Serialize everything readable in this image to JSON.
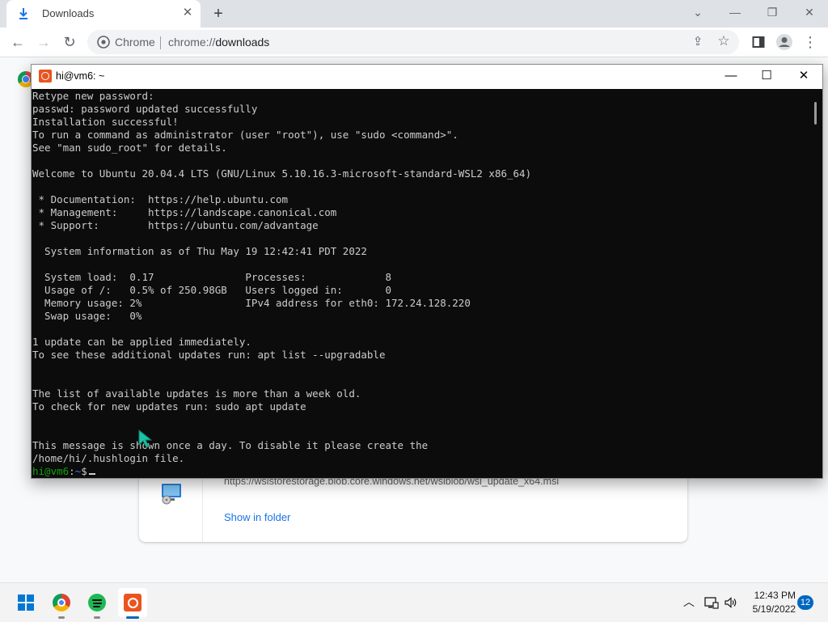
{
  "browser": {
    "tab": {
      "title": "Downloads",
      "icon": "download-icon"
    },
    "omnibox": {
      "site": "Chrome",
      "url_scheme": "chrome://",
      "url_path": "downloads"
    },
    "download_item": {
      "url": "https://wslstorestorage.blob.core.windows.net/wslblob/wsl_update_x64.msi",
      "show_in_folder": "Show in folder"
    }
  },
  "terminal": {
    "title": "hi@vm6: ~",
    "lines": [
      "Retype new password:",
      "passwd: password updated successfully",
      "Installation successful!",
      "To run a command as administrator (user \"root\"), use \"sudo <command>\".",
      "See \"man sudo_root\" for details.",
      "",
      "Welcome to Ubuntu 20.04.4 LTS (GNU/Linux 5.10.16.3-microsoft-standard-WSL2 x86_64)",
      "",
      " * Documentation:  https://help.ubuntu.com",
      " * Management:     https://landscape.canonical.com",
      " * Support:        https://ubuntu.com/advantage",
      "",
      "  System information as of Thu May 19 12:42:41 PDT 2022",
      "",
      "  System load:  0.17               Processes:             8",
      "  Usage of /:   0.5% of 250.98GB   Users logged in:       0",
      "  Memory usage: 2%                 IPv4 address for eth0: 172.24.128.220",
      "  Swap usage:   0%",
      "",
      "1 update can be applied immediately.",
      "To see these additional updates run: apt list --upgradable",
      "",
      "",
      "The list of available updates is more than a week old.",
      "To check for new updates run: sudo apt update",
      "",
      "",
      "This message is shown once a day. To disable it please create the",
      "/home/hi/.hushlogin file."
    ],
    "prompt": {
      "user_host": "hi@vm6",
      "separator": ":",
      "path": "~",
      "symbol": "$"
    }
  },
  "taskbar": {
    "apps": [
      "windows-start",
      "chrome",
      "spotify",
      "ubuntu-terminal"
    ],
    "clock": {
      "time": "12:43 PM",
      "date": "5/19/2022"
    },
    "notifications": "12"
  },
  "colors": {
    "terminal_bg": "#0c0c0c",
    "terminal_fg": "#cccccc",
    "prompt_user": "#13a10e",
    "prompt_path": "#3b78ff",
    "ubuntu_orange": "#e95420",
    "link_blue": "#1a73e8"
  }
}
